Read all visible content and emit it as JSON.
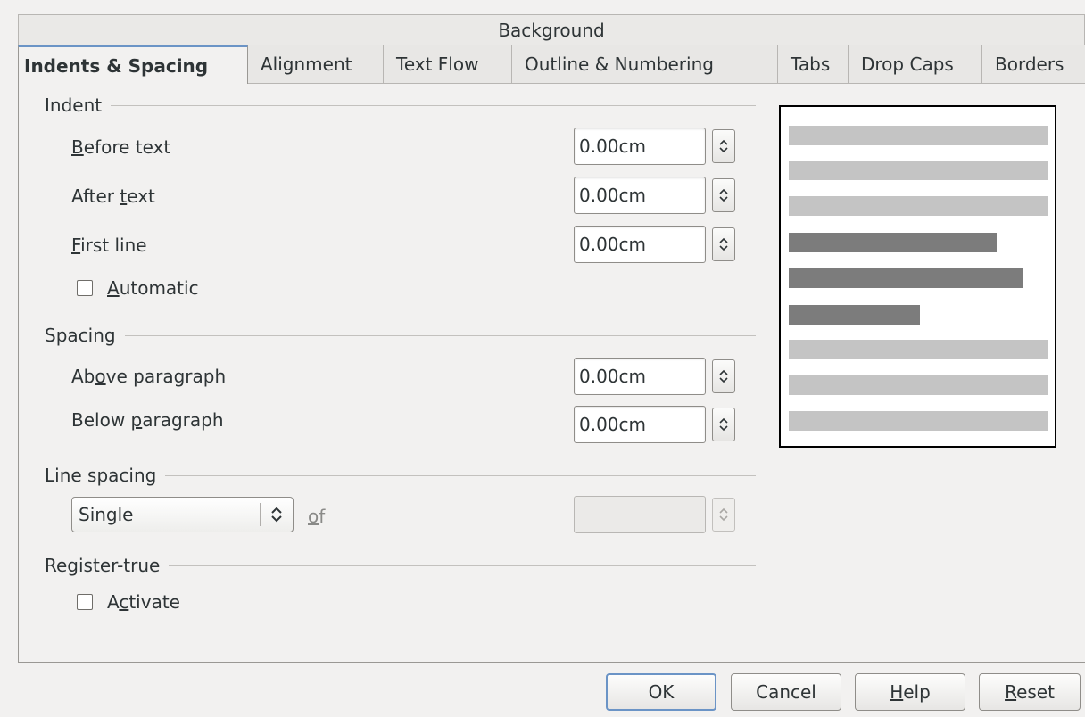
{
  "tabs_top": {
    "background": "Background"
  },
  "tabs": [
    {
      "label": "Indents & Spacing"
    },
    {
      "label": "Alignment"
    },
    {
      "label": "Text Flow"
    },
    {
      "label": "Outline & Numbering"
    },
    {
      "label": "Tabs"
    },
    {
      "label": "Drop Caps"
    },
    {
      "label": "Borders"
    }
  ],
  "indent": {
    "title": "Indent",
    "before_text": {
      "pre": "",
      "mn": "B",
      "post": "efore text",
      "value": "0.00cm"
    },
    "after_text": {
      "pre": "After ",
      "mn": "t",
      "post": "ext",
      "value": "0.00cm"
    },
    "first_line": {
      "pre": "",
      "mn": "F",
      "post": "irst line",
      "value": "0.00cm"
    },
    "automatic": {
      "pre": "",
      "mn": "A",
      "post": "utomatic",
      "checked": false
    }
  },
  "spacing": {
    "title": "Spacing",
    "above": {
      "pre": "Ab",
      "mn": "o",
      "post": "ve paragraph",
      "value": "0.00cm"
    },
    "below": {
      "pre": "Below ",
      "mn": "p",
      "post": "aragraph",
      "value": "0.00cm"
    }
  },
  "line_spacing": {
    "title": "Line spacing",
    "selected": "Single",
    "of": {
      "pre": "",
      "mn": "o",
      "post": "f"
    },
    "value": ""
  },
  "register_true": {
    "title": "Register-true",
    "activate": {
      "pre": "A",
      "mn": "c",
      "post": "tivate",
      "checked": false
    }
  },
  "buttons": {
    "ok": "OK",
    "cancel": "Cancel",
    "help": {
      "pre": "",
      "mn": "H",
      "post": "elp"
    },
    "reset": {
      "pre": "",
      "mn": "R",
      "post": "eset"
    }
  },
  "colors": {
    "preview_light": "#c4c4c4",
    "preview_dark": "#7c7c7c",
    "accent": "#6b94c6"
  }
}
